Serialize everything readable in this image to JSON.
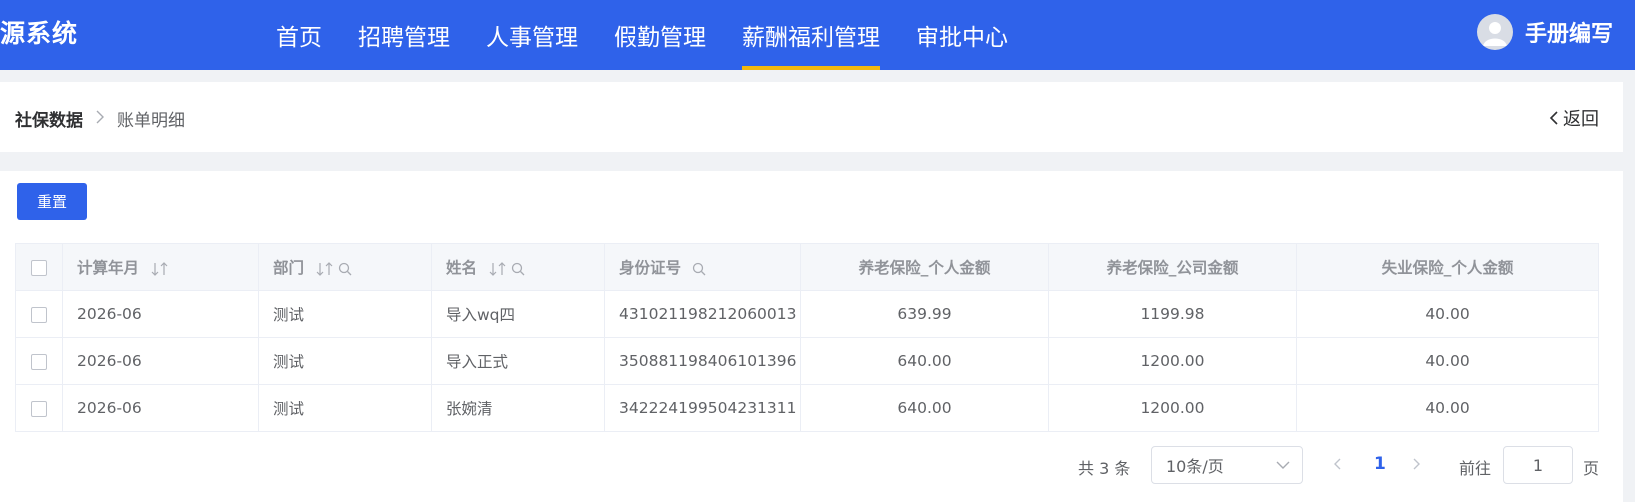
{
  "app": {
    "title": "源系统"
  },
  "nav": {
    "items": [
      {
        "label": "首页"
      },
      {
        "label": "招聘管理"
      },
      {
        "label": "人事管理"
      },
      {
        "label": "假勤管理"
      },
      {
        "label": "薪酬福利管理",
        "active": true
      },
      {
        "label": "审批中心"
      }
    ]
  },
  "user": {
    "name": "手册编写"
  },
  "breadcrumb": {
    "root": "社保数据",
    "current": "账单明细"
  },
  "back": {
    "label": "返回"
  },
  "toolbar": {
    "reset_label": "重置"
  },
  "table": {
    "columns": [
      {
        "label": "计算年月",
        "icons": [
          "sort"
        ]
      },
      {
        "label": "部门",
        "icons": [
          "sort",
          "search"
        ]
      },
      {
        "label": "姓名",
        "icons": [
          "sort",
          "search"
        ]
      },
      {
        "label": "身份证号",
        "icons": [
          "search"
        ]
      },
      {
        "label": "养老保险_个人金额"
      },
      {
        "label": "养老保险_公司金额"
      },
      {
        "label": "失业保险_个人金额"
      }
    ],
    "rows": [
      [
        "2026-06",
        "测试",
        "导入wq四",
        "431021198212060013",
        "639.99",
        "1199.98",
        "40.00"
      ],
      [
        "2026-06",
        "测试",
        "导入正式",
        "350881198406101396",
        "640.00",
        "1200.00",
        "40.00"
      ],
      [
        "2026-06",
        "测试",
        "张婉清",
        "342224199504231311",
        "640.00",
        "1200.00",
        "40.00"
      ]
    ]
  },
  "pagination": {
    "total_text": "共 3 条",
    "page_size": "10条/页",
    "current_page": "1",
    "goto_label": "前往",
    "goto_value": "1",
    "goto_suffix": "页"
  },
  "colors": {
    "primary": "#2f62ea",
    "active_underline": "#f2b80c"
  }
}
